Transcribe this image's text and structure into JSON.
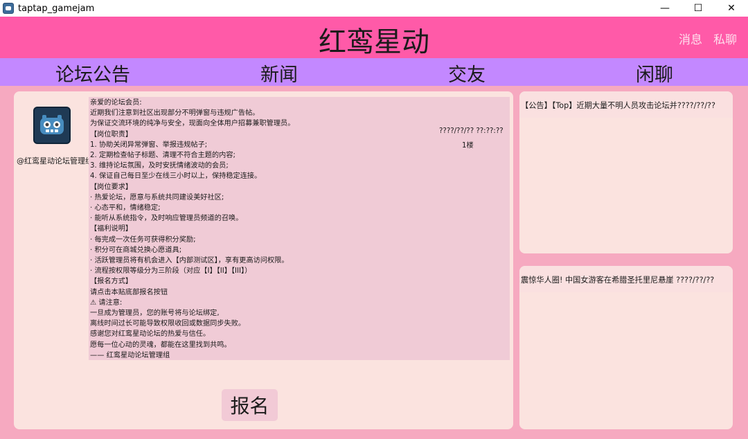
{
  "window": {
    "title": "taptap_gamejam",
    "controls": {
      "minimize": "—",
      "maximize": "☐",
      "close": "✕"
    }
  },
  "header": {
    "site_title": "红鸾星动",
    "links": {
      "messages": "消息",
      "private_chat": "私聊"
    }
  },
  "nav": {
    "items": [
      "论坛公告",
      "新闻",
      "交友",
      "闲聊"
    ]
  },
  "post": {
    "author": "@红鸾星动论坛管理组",
    "time": "????/??/?? ??:??:??",
    "floor": "1楼",
    "lines": [
      "亲爱的论坛会员:",
      "近期我们注意到社区出现部分不明弹窗与违规广告帖。",
      " 为保证交流环境的纯净与安全，现面向全体用户招募兼职管理员。",
      "【岗位职责】",
      "1. 协助关闭异常弹窗、举报违规帖子;",
      "2. 定期检查帖子标题、清理不符合主题的内容;",
      "3. 维持论坛氛围，及时安抚情绪波动的会员;",
      "4. 保证自己每日至少在线三小时以上，保持稳定连接。",
      "【岗位要求】",
      "· 热爱论坛，愿意与系统共同建设美好社区;",
      "· 心态平和，情绪稳定;",
      "· 能听从系统指令，及时响应管理员频道的召唤。",
      "【福利说明】",
      "· 每完成一次任务可获得积分奖励;",
      "· 积分可在商城兑换心愿道具;",
      "· 活跃管理员将有机会进入【内部测试区】，享有更高访问权限。",
      "· 流程按权限等级分为三阶段（对应【I】【II】【III】）",
      "【报名方式】",
      " 请点击本贴底部报名按钮",
      "⚠ 请注意:",
      " 一旦成为管理员，您的账号将与论坛绑定,",
      " 离线时间过长可能导致权限收回或数据同步失败。",
      "感谢您对红鸾星动论坛的热爱与信任。",
      " 愿每一位心动的灵魂，都能在这里找到共鸣。",
      "—— 红鸾星动论坛管理组"
    ],
    "apply_button": "报名"
  },
  "sidebar": {
    "announcements": [
      {
        "text": "【公告】【Top】近期大量不明人员攻击论坛并????/??/??"
      }
    ],
    "news": [
      {
        "text": "震惊华人圈! 中国女游客在希腊圣托里尼悬崖 ????/??/??"
      }
    ]
  },
  "colors": {
    "header_bg": "#ff5aa8",
    "nav_bg": "#c388ff",
    "page_bg": "#f6a9c0",
    "panel_bg": "#fbe3df",
    "post_body_bg": "#f0cbd6"
  }
}
